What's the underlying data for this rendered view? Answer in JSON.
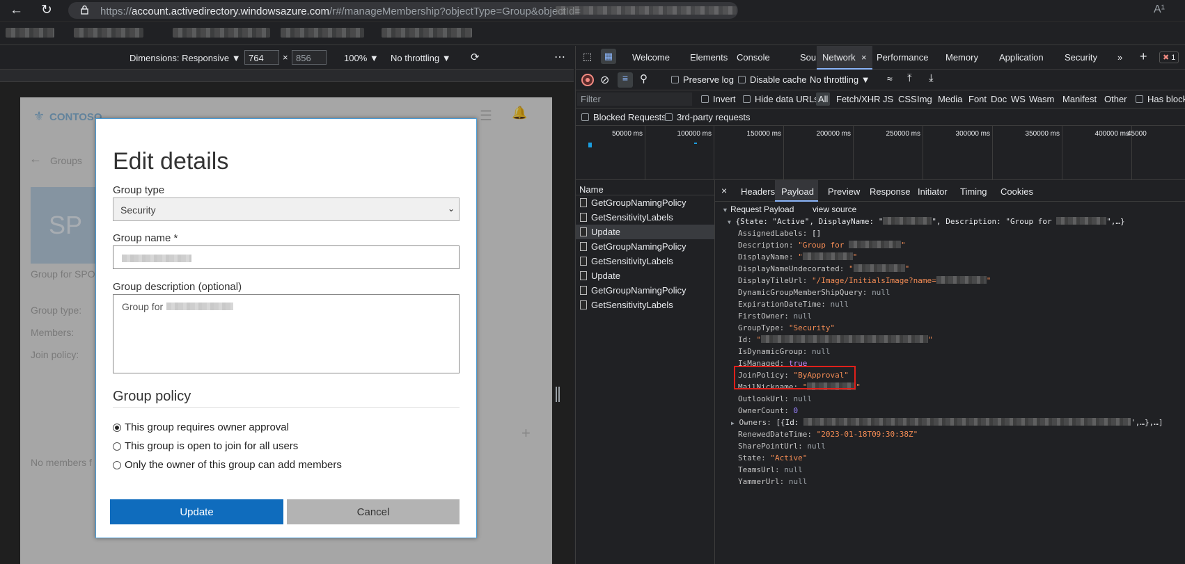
{
  "browser": {
    "url_prefix": "https://",
    "url_host": "account.activedirectory.windowsazure.com",
    "url_path": "/r#/manageMembership?objectType=Group&objectId=",
    "read_aloud_icon": "A¹"
  },
  "device_toolbar": {
    "dimensions_label": "Dimensions: Responsive",
    "width": "764",
    "height": "856",
    "times": "×",
    "zoom": "100%",
    "throttling": "No throttling"
  },
  "app": {
    "logo_text": "CONTOSO",
    "back_label": "Groups",
    "avatar_initials": "SP",
    "group_desc_short": "Group for SPO",
    "props": [
      "Group type:",
      "Members:",
      "Join policy:"
    ],
    "no_members": "No members f"
  },
  "modal": {
    "title": "Edit details",
    "group_type_label": "Group type",
    "group_type_value": "Security",
    "group_name_label": "Group name *",
    "group_desc_label": "Group description (optional)",
    "group_desc_value": "Group for",
    "policy_heading": "Group policy",
    "policies": [
      {
        "label": "This group requires owner approval",
        "checked": true
      },
      {
        "label": "This group is open to join for all users",
        "checked": false
      },
      {
        "label": "Only the owner of this group can add members",
        "checked": false
      }
    ],
    "update_label": "Update",
    "cancel_label": "Cancel",
    "primary_color": "#0f6cbd"
  },
  "devtools": {
    "tabs": [
      "Welcome",
      "Elements",
      "Console",
      "Sources",
      "Network",
      "Performance",
      "Memory",
      "Application",
      "Security"
    ],
    "active_tab": "Network",
    "error_count": "1",
    "toolbar": {
      "preserve_log": "Preserve log",
      "disable_cache": "Disable cache",
      "throttling": "No throttling"
    },
    "filter": {
      "placeholder": "Filter",
      "invert": "Invert",
      "hide_data_urls": "Hide data URLs",
      "types": [
        "All",
        "Fetch/XHR",
        "JS",
        "CSS",
        "Img",
        "Media",
        "Font",
        "Doc",
        "WS",
        "Wasm",
        "Manifest",
        "Other"
      ],
      "has_blocked": "Has blocked"
    },
    "blocked_requests": "Blocked Requests",
    "third_party": "3rd-party requests",
    "timeline_ticks": [
      "50000 ms",
      "100000 ms",
      "150000 ms",
      "200000 ms",
      "250000 ms",
      "300000 ms",
      "350000 ms",
      "400000 ms",
      "45000"
    ],
    "name_header": "Name",
    "requests": [
      "GetGroupNamingPolicy",
      "GetSensitivityLabels",
      "Update",
      "GetGroupNamingPolicy",
      "GetSensitivityLabels",
      "Update",
      "GetGroupNamingPolicy",
      "GetSensitivityLabels"
    ],
    "selected_request": 2,
    "detail_tabs": [
      "Headers",
      "Payload",
      "Preview",
      "Response",
      "Initiator",
      "Timing",
      "Cookies"
    ],
    "active_detail_tab": "Payload",
    "request_payload_label": "Request Payload",
    "view_source": "view source",
    "payload": {
      "summary_a": "{State: \"Active\", DisplayName: \"",
      "summary_b": "\", Description: \"Group for ",
      "summary_c": "\",…}",
      "assigned_labels": "[]",
      "description": "\"Group for ",
      "display_name": "\"",
      "display_name_undecorated": "\"",
      "display_tile_url": "\"/Image/InitialsImage?name=",
      "group_type": "\"Security\"",
      "id": "\"",
      "join_policy": "\"ByApproval\"",
      "mail_nickname": "\"",
      "owner_count": "0",
      "owners": "[{Id: ",
      "owners_tail": "',…},…]",
      "renewed": "\"2023-01-18T09:30:38Z\"",
      "state": "\"Active\"",
      "true": "true",
      "null": "null",
      "quote": "\"",
      "keys": [
        "AssignedLabels:",
        "Description:",
        "DisplayName:",
        "DisplayNameUndecorated:",
        "DisplayTileUrl:",
        "DynamicGroupMemberShipQuery:",
        "ExpirationDateTime:",
        "FirstOwner:",
        "GroupType:",
        "Id:",
        "IsDynamicGroup:",
        "IsManaged:",
        "JoinPolicy:",
        "MailNickname:",
        "OutlookUrl:",
        "OwnerCount:",
        "Owners:",
        "RenewedDateTime:",
        "SharePointUrl:",
        "State:",
        "TeamsUrl:",
        "YammerUrl:"
      ]
    },
    "highlight_color": "#e0201a"
  }
}
